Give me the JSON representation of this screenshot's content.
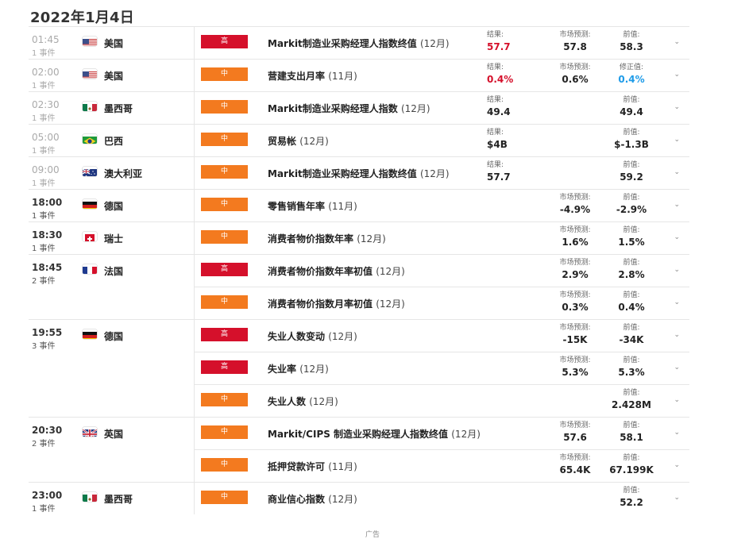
{
  "page": {
    "title": "2022年1月4日",
    "footer": "广告"
  },
  "icons": {
    "chevron": "chevron-down-icon"
  },
  "colors": {
    "high": "#d5102b",
    "mid": "#f37a1f",
    "red_value": "#d5102b",
    "blue_value": "#1e9be8"
  },
  "groups": [
    {
      "time": "01:45",
      "count": "1 事件",
      "past": true,
      "flag": "us",
      "country": "美国",
      "events": [
        {
          "importance": "高",
          "level": "high",
          "name": "Markit制造业采购经理人指数终值",
          "period": "(12月)",
          "c1": {
            "label": "结果:",
            "value": "57.7",
            "color": "red"
          },
          "c2": {
            "label": "市场预测:",
            "value": "57.8"
          },
          "c3": {
            "label": "前值:",
            "value": "58.3"
          }
        }
      ]
    },
    {
      "time": "02:00",
      "count": "1 事件",
      "past": true,
      "flag": "us",
      "country": "美国",
      "events": [
        {
          "importance": "中",
          "level": "mid",
          "name": "营建支出月率",
          "period": "(11月)",
          "c1": {
            "label": "结果:",
            "value": "0.4%",
            "color": "red"
          },
          "c2": {
            "label": "市场预测:",
            "value": "0.6%"
          },
          "c3": {
            "label": "修正值:",
            "value": "0.4%",
            "color": "blue"
          }
        }
      ]
    },
    {
      "time": "02:30",
      "count": "1 事件",
      "past": true,
      "flag": "mx",
      "country": "墨西哥",
      "events": [
        {
          "importance": "中",
          "level": "mid",
          "name": "Markit制造业采购经理人指数",
          "period": "(12月)",
          "c1": {
            "label": "结果:",
            "value": "49.4"
          },
          "c3": {
            "label": "前值:",
            "value": "49.4"
          }
        }
      ]
    },
    {
      "time": "05:00",
      "count": "1 事件",
      "past": true,
      "flag": "br",
      "country": "巴西",
      "events": [
        {
          "importance": "中",
          "level": "mid",
          "name": "贸易帐",
          "period": "(12月)",
          "c1": {
            "label": "结果:",
            "value": "$4B"
          },
          "c3": {
            "label": "前值:",
            "value": "$-1.3B"
          }
        }
      ]
    },
    {
      "time": "09:00",
      "count": "1 事件",
      "past": true,
      "flag": "au",
      "country": "澳大利亚",
      "events": [
        {
          "importance": "中",
          "level": "mid",
          "name": "Markit制造业采购经理人指数终值",
          "period": "(12月)",
          "c1": {
            "label": "结果:",
            "value": "57.7"
          },
          "c3": {
            "label": "前值:",
            "value": "59.2"
          }
        }
      ]
    },
    {
      "time": "18:00",
      "count": "1 事件",
      "past": false,
      "flag": "de",
      "country": "德国",
      "events": [
        {
          "importance": "中",
          "level": "mid",
          "name": "零售销售年率",
          "period": "(11月)",
          "c2": {
            "label": "市场预测:",
            "value": "-4.9%"
          },
          "c3": {
            "label": "前值:",
            "value": "-2.9%"
          }
        }
      ]
    },
    {
      "time": "18:30",
      "count": "1 事件",
      "past": false,
      "flag": "ch",
      "country": "瑞士",
      "events": [
        {
          "importance": "中",
          "level": "mid",
          "name": "消费者物价指数年率",
          "period": "(12月)",
          "c2": {
            "label": "市场预测:",
            "value": "1.6%"
          },
          "c3": {
            "label": "前值:",
            "value": "1.5%"
          }
        }
      ]
    },
    {
      "time": "18:45",
      "count": "2 事件",
      "past": false,
      "flag": "fr",
      "country": "法国",
      "events": [
        {
          "importance": "高",
          "level": "high",
          "name": "消费者物价指数年率初值",
          "period": "(12月)",
          "c2": {
            "label": "市场预测:",
            "value": "2.9%"
          },
          "c3": {
            "label": "前值:",
            "value": "2.8%"
          }
        },
        {
          "importance": "中",
          "level": "mid",
          "name": "消费者物价指数月率初值",
          "period": "(12月)",
          "c2": {
            "label": "市场预测:",
            "value": "0.3%"
          },
          "c3": {
            "label": "前值:",
            "value": "0.4%"
          }
        }
      ]
    },
    {
      "time": "19:55",
      "count": "3 事件",
      "past": false,
      "flag": "de",
      "country": "德国",
      "events": [
        {
          "importance": "高",
          "level": "high",
          "name": "失业人数变动",
          "period": "(12月)",
          "c2": {
            "label": "市场预测:",
            "value": "-15K"
          },
          "c3": {
            "label": "前值:",
            "value": "-34K"
          }
        },
        {
          "importance": "高",
          "level": "high",
          "name": "失业率",
          "period": "(12月)",
          "c2": {
            "label": "市场预测:",
            "value": "5.3%"
          },
          "c3": {
            "label": "前值:",
            "value": "5.3%"
          }
        },
        {
          "importance": "中",
          "level": "mid",
          "name": "失业人数",
          "period": "(12月)",
          "c3": {
            "label": "前值:",
            "value": "2.428M"
          }
        }
      ]
    },
    {
      "time": "20:30",
      "count": "2 事件",
      "past": false,
      "flag": "gb",
      "country": "英国",
      "events": [
        {
          "importance": "中",
          "level": "mid",
          "name": "Markit/CIPS 制造业采购经理人指数终值",
          "period": "(12月)",
          "c2": {
            "label": "市场预测:",
            "value": "57.6"
          },
          "c3": {
            "label": "前值:",
            "value": "58.1"
          }
        },
        {
          "importance": "中",
          "level": "mid",
          "name": "抵押贷款许可",
          "period": "(11月)",
          "c2": {
            "label": "市场预测:",
            "value": "65.4K"
          },
          "c3": {
            "label": "前值:",
            "value": "67.199K"
          }
        }
      ]
    },
    {
      "time": "23:00",
      "count": "1 事件",
      "past": false,
      "flag": "mx",
      "country": "墨西哥",
      "events": [
        {
          "importance": "中",
          "level": "mid",
          "name": "商业信心指数",
          "period": "(12月)",
          "c3": {
            "label": "前值:",
            "value": "52.2"
          }
        }
      ]
    }
  ]
}
